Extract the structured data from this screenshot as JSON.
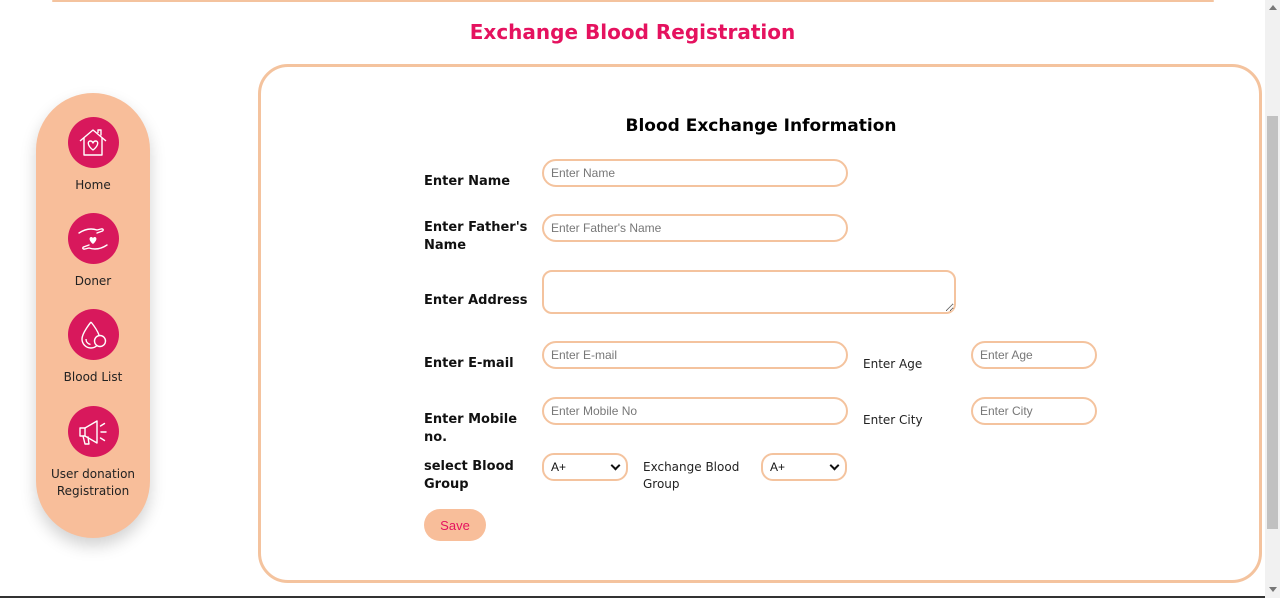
{
  "page": {
    "title": "Exchange Blood Registration"
  },
  "sidebar": {
    "items": [
      {
        "label": "Home",
        "icon": "home-heart-icon"
      },
      {
        "label": "Doner",
        "icon": "hand-heart-icon"
      },
      {
        "label": "Blood List",
        "icon": "blood-drop-icon"
      },
      {
        "label": "User donation Registration",
        "icon": "megaphone-icon"
      }
    ]
  },
  "form": {
    "heading": "Blood Exchange Information",
    "name": {
      "label": "Enter Name",
      "placeholder": "Enter Name"
    },
    "father": {
      "label": "Enter Father's Name",
      "placeholder": "Enter Father's Name"
    },
    "address": {
      "label": "Enter Address",
      "placeholder": ""
    },
    "email": {
      "label": "Enter E-mail",
      "placeholder": "Enter E-mail"
    },
    "age": {
      "label": "Enter Age",
      "placeholder": "Enter Age"
    },
    "mobile": {
      "label": "Enter Mobile no.",
      "placeholder": "Enter Mobile No"
    },
    "city": {
      "label": "Enter City",
      "placeholder": "Enter City"
    },
    "blood_group": {
      "label": "select Blood Group",
      "value": "A+"
    },
    "exchange_group": {
      "label": "Exchange Blood Group",
      "value": "A+"
    },
    "save_label": "Save"
  },
  "colors": {
    "accent": "#e5125f",
    "peach": "#f8be9a",
    "border": "#f4c39e",
    "icon_bg": "#d8185c"
  }
}
